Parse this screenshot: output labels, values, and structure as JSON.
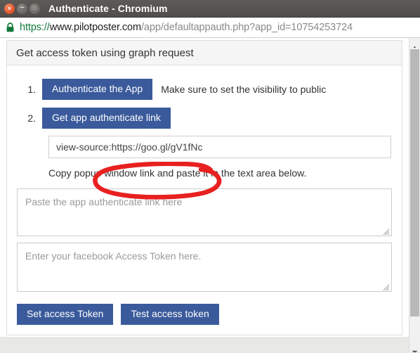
{
  "window": {
    "title": "Authenticate - Chromium",
    "controls": [
      {
        "name": "close",
        "glyph": "×"
      },
      {
        "name": "minimize",
        "glyph": "−"
      },
      {
        "name": "maximize",
        "glyph": "□"
      }
    ]
  },
  "addressbar": {
    "security_icon": "lock-icon",
    "url_full": "https://www.pilotposter.com/app/defaultappauth.php?app_id=10754253724",
    "url_scheme": "https://",
    "url_host": "www.pilotposter.com",
    "url_path": "/app/defaultappauth.php?app_id=10754253724"
  },
  "card": {
    "header_title": "Get access token using graph request",
    "steps": [
      {
        "number": "1.",
        "button_label": "Authenticate the App",
        "note": "Make sure to set the visibility to public"
      },
      {
        "number": "2.",
        "button_label": "Get app authenticate link"
      }
    ],
    "link_field": {
      "value": "view-source:https://goo.gl/gV1fNc",
      "placeholder": ""
    },
    "helper_text": "Copy popup window link and paste it in the text area below.",
    "textareas": [
      {
        "placeholder": "Paste the app authenticate link here",
        "value": ""
      },
      {
        "placeholder": "Enter your facebook Access Token here.",
        "value": ""
      }
    ],
    "actions": [
      {
        "label": "Set access Token"
      },
      {
        "label": "Test access token"
      }
    ]
  },
  "annotation": {
    "name": "red-circle-highlight",
    "color": "#e82020",
    "targets_text": "https://goo.gl/gV1fNc"
  },
  "colors": {
    "button_blue": "#3a5a9b",
    "titlebar": "#544f4c",
    "card_header_bg": "#f5f5f5",
    "annotation_red": "#e82020",
    "lock_green": "#11793a"
  },
  "scrollbar": {
    "up_arrow": "scroll-up-icon",
    "down_arrow": "scroll-down-icon"
  }
}
